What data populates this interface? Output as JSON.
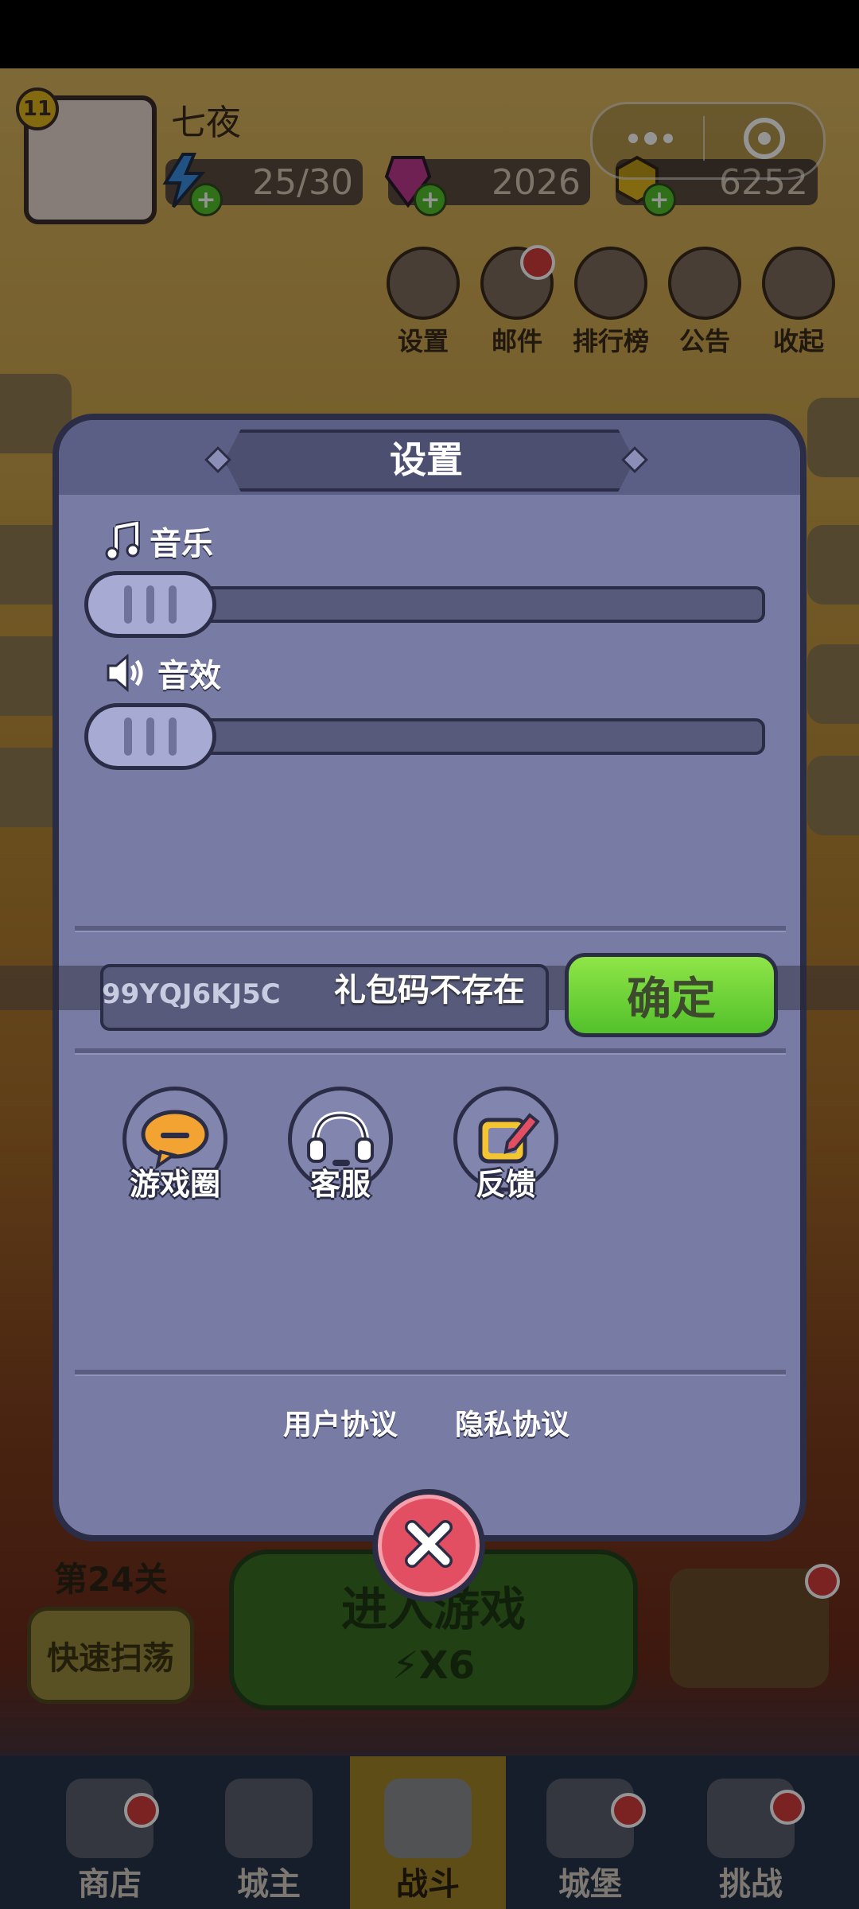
{
  "player": {
    "name": "七夜",
    "level": "11"
  },
  "resources": {
    "energy": "25/30",
    "gems": "2026",
    "coins": "6252"
  },
  "top_buttons": [
    {
      "label": "设置"
    },
    {
      "label": "邮件"
    },
    {
      "label": "排行榜"
    },
    {
      "label": "公告"
    },
    {
      "label": "收起"
    }
  ],
  "settings": {
    "title": "设置",
    "music_label": "音乐",
    "sfx_label": "音效",
    "music_level": 0,
    "sfx_level": 0,
    "gift_code": {
      "value": "99YQJ6KJ5C",
      "toast": "礼包码不存在",
      "confirm_label": "确定"
    },
    "actions": [
      {
        "label": "游戏圈"
      },
      {
        "label": "客服"
      },
      {
        "label": "反馈"
      }
    ],
    "links": {
      "user_agreement": "用户协议",
      "privacy": "隐私协议"
    }
  },
  "stage": {
    "label": "第24关",
    "sweep_label": "快速扫荡",
    "enter_label": "进入游戏",
    "energy_cost": "X6"
  },
  "bottom_nav": [
    {
      "label": "商店"
    },
    {
      "label": "城主"
    },
    {
      "label": "战斗"
    },
    {
      "label": "城堡"
    },
    {
      "label": "挑战"
    }
  ],
  "colors": {
    "panel": "#787ba3",
    "confirm": "#53c12b",
    "close": "#e34f62",
    "nav_active": "#a38628"
  }
}
